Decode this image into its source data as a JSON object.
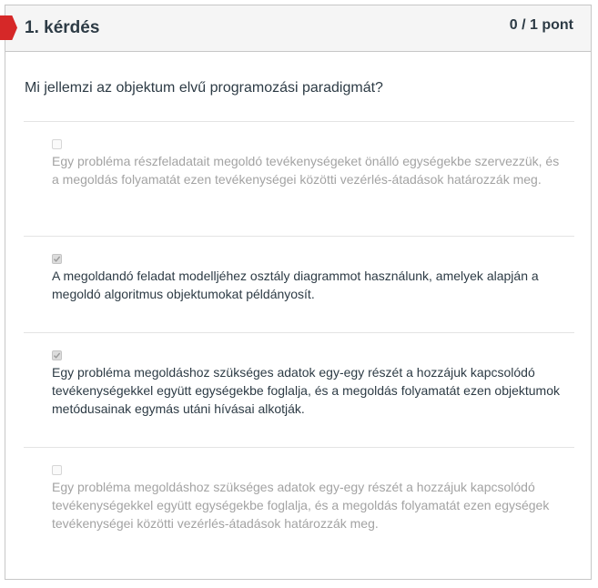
{
  "question": {
    "title": "1. kérdés",
    "points": "0 / 1 pont",
    "text": "Mi jellemzi az objektum elvű programozási paradigmát?"
  },
  "answers": [
    {
      "checked": false,
      "text": "Egy probléma részfeladatait megoldó tevékenységeket önálló egységekbe szervezzük, és a megoldás folyamatát ezen tevékenységei közötti vezérlés-átadások határozzák meg."
    },
    {
      "checked": true,
      "text": "A megoldandó feladat modelljéhez osztály diagrammot használunk, amelyek alapján a megoldó algoritmus objektumokat példányosít."
    },
    {
      "checked": true,
      "text": "Egy probléma megoldáshoz szükséges adatok egy-egy részét a hozzájuk kapcsolódó tevékenységekkel együtt egységekbe foglalja, és a megoldás folyamatát ezen objektumok metódusainak egymás utáni hívásai alkotják."
    },
    {
      "checked": false,
      "text": "Egy probléma megoldáshoz szükséges adatok egy-egy részét a hozzájuk kapcsolódó tevékenységekkel együtt egységekbe foglalja, és a megoldás folyamatát ezen egységek tevékenységei közötti vezérlés-átadások határozzák meg."
    }
  ],
  "colors": {
    "flag": "#d62828",
    "text": "#2d3b45",
    "muted_text": "#a3a3a3",
    "border": "#c7c7c7",
    "header_bg": "#f5f5f5"
  }
}
